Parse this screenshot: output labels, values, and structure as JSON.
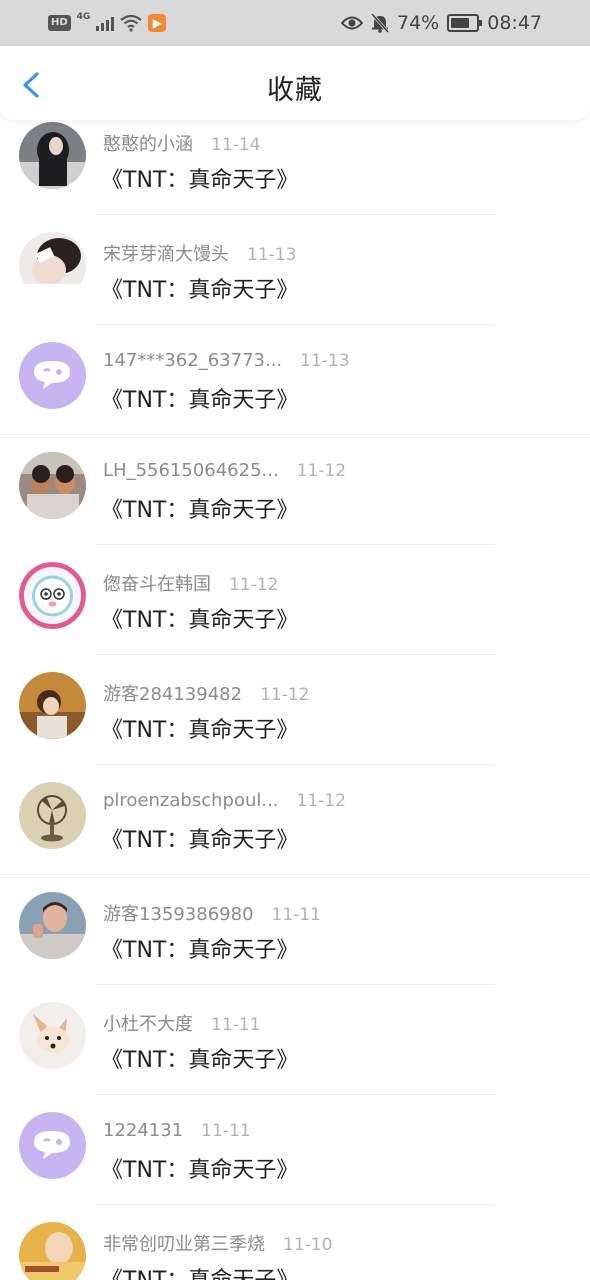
{
  "status_bar": {
    "hd": "HD",
    "network": "4G",
    "battery_percent": "74%",
    "battery_level": 0.74,
    "time": "08:47",
    "icons": [
      "hd-icon",
      "signal-icon",
      "wifi-icon",
      "app-notification-icon",
      "eye-icon",
      "mute-bell-icon",
      "battery-icon"
    ]
  },
  "header": {
    "title": "收藏",
    "back_icon": "chevron-left-icon",
    "accent_color": "#3d8ff0"
  },
  "items": [
    {
      "name": "憨憨的小涵",
      "date": "11-14",
      "title": "《TNT：真命天子》"
    },
    {
      "name": "宋芽芽滴大馒头",
      "date": "11-13",
      "title": "《TNT：真命天子》"
    },
    {
      "name": "147***362_63773...",
      "date": "11-13",
      "title": "《TNT：真命天子》"
    },
    {
      "name": "LH_55615064625...",
      "date": "11-12",
      "title": "《TNT：真命天子》"
    },
    {
      "name": "偬奋斗在韩国",
      "date": "11-12",
      "title": "《TNT：真命天子》"
    },
    {
      "name": "游客284139482",
      "date": "11-12",
      "title": "《TNT：真命天子》"
    },
    {
      "name": "plroenzabschpoul...",
      "date": "11-12",
      "title": "《TNT：真命天子》"
    },
    {
      "name": "游客1359386980",
      "date": "11-11",
      "title": "《TNT：真命天子》"
    },
    {
      "name": "小杜不大度",
      "date": "11-11",
      "title": "《TNT：真命天子》"
    },
    {
      "name": "1224131",
      "date": "11-11",
      "title": "《TNT：真命天子》"
    },
    {
      "name": "非常创叨业第三季烧",
      "date": "11-10",
      "title": "《TNT：真命天子》"
    }
  ]
}
